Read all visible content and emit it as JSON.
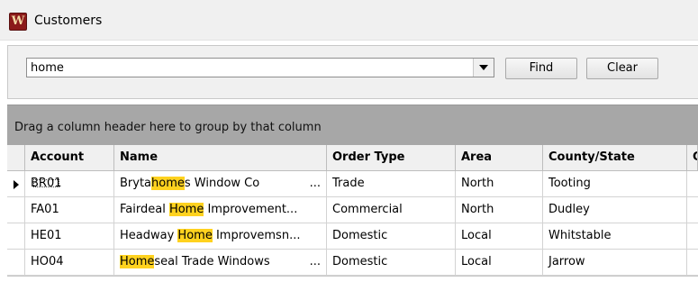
{
  "window": {
    "title": "Customers",
    "app_icon_letter": "W"
  },
  "search": {
    "value": "home",
    "find_label": "Find",
    "clear_label": "Clear"
  },
  "group_panel": {
    "hint": "Drag a column header here to group by that column"
  },
  "columns": [
    "Account",
    "Name",
    "Order Type",
    "Area",
    "County/State",
    "C"
  ],
  "rows": [
    {
      "account": "BR01",
      "name_pre": "Bryta",
      "name_hl": "home",
      "name_post": "s Window Co",
      "ellipsis": "...",
      "order_type": "Trade",
      "area": "North",
      "county": "Tooting"
    },
    {
      "account": "FA01",
      "name_pre": "Fairdeal ",
      "name_hl": "Home",
      "name_post": " Improvement...",
      "ellipsis": "",
      "order_type": "Commercial",
      "area": "North",
      "county": "Dudley"
    },
    {
      "account": "HE01",
      "name_pre": "Headway ",
      "name_hl": "Home",
      "name_post": " Improvemsn...",
      "ellipsis": "",
      "order_type": "Domestic",
      "area": "Local",
      "county": "Whitstable"
    },
    {
      "account": "HO04",
      "name_pre": "",
      "name_hl": "Home",
      "name_post": "seal Trade Windows",
      "ellipsis": "...",
      "order_type": "Domestic",
      "area": "Local",
      "county": "Jarrow"
    }
  ],
  "colors": {
    "highlight": "#ffd21f",
    "group_panel": "#a7a7a7",
    "app_icon": "#8b1a1a"
  }
}
